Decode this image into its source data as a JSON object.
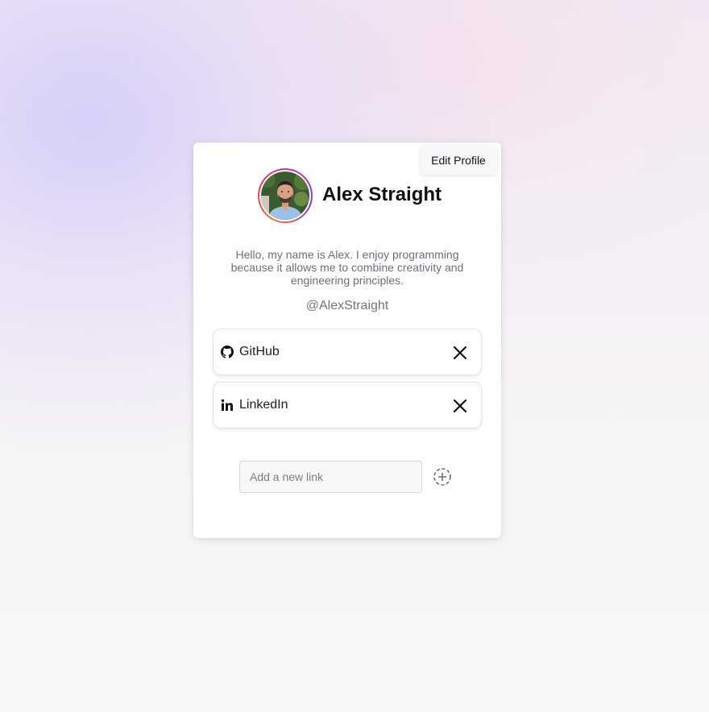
{
  "profile": {
    "edit_label": "Edit Profile",
    "name": "Alex Straight",
    "bio": "Hello, my name is Alex. I enjoy programming because it allows me to combine creativity and engineering principles.",
    "handle": "@AlexStraight",
    "avatar_alt": "Alex Straight"
  },
  "links": [
    {
      "label": "GitHub",
      "icon": "github-icon"
    },
    {
      "label": "LinkedIn",
      "icon": "linkedin-icon"
    }
  ],
  "new_link": {
    "value": "",
    "placeholder": "Add a new link"
  },
  "icons": {
    "remove": "close-icon",
    "add": "plus-circle-dashed-icon"
  },
  "colors": {
    "avatar_ring": [
      "#e27a2f",
      "#d93a6a",
      "#b536b5",
      "#8e3bd0"
    ],
    "text_primary": "#111111",
    "text_secondary": "#6b6f78"
  }
}
